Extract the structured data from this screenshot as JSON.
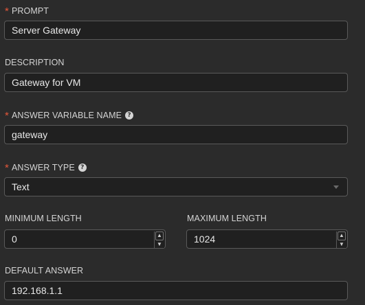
{
  "fields": {
    "prompt": {
      "label": "PROMPT",
      "value": "Server Gateway",
      "required": "*"
    },
    "description": {
      "label": "DESCRIPTION",
      "value": "Gateway for VM"
    },
    "answer_variable_name": {
      "label": "ANSWER VARIABLE NAME",
      "value": "gateway",
      "required": "*",
      "help_icon": "question-circle-icon"
    },
    "answer_type": {
      "label": "ANSWER TYPE",
      "value": "Text",
      "required": "*",
      "help_icon": "question-circle-icon"
    },
    "minimum_length": {
      "label": "MINIMUM LENGTH",
      "value": "0"
    },
    "maximum_length": {
      "label": "MAXIMUM LENGTH",
      "value": "1024"
    },
    "default_answer": {
      "label": "DEFAULT ANSWER",
      "value": "192.168.1.1"
    }
  },
  "spinner": {
    "up": "▲",
    "down": "▼"
  },
  "colors": {
    "background": "#2b2b2b",
    "input_background": "#202020",
    "border": "#5a5a5a",
    "label": "#d4d4d4",
    "required_asterisk": "#e5573a",
    "text": "#e8e8e8"
  }
}
